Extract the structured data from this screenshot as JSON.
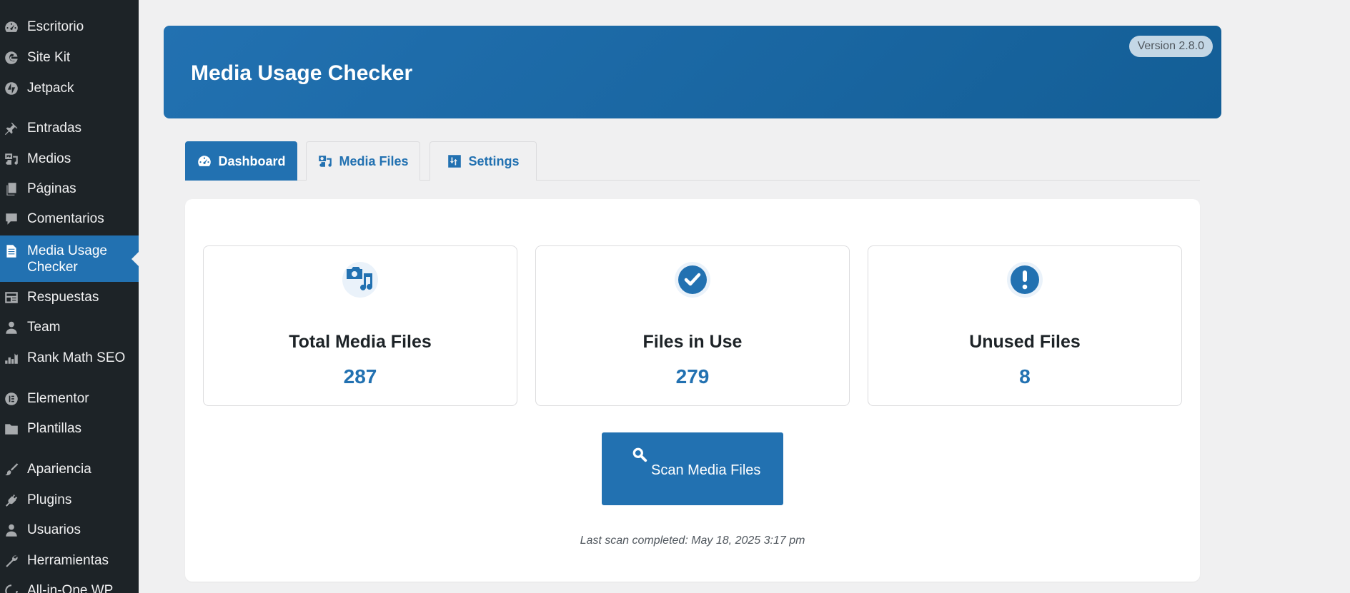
{
  "sidebar": {
    "items": [
      {
        "label": "Escritorio",
        "icon": "dashboard-icon"
      },
      {
        "label": "Site Kit",
        "icon": "google-g-icon"
      },
      {
        "label": "Jetpack",
        "icon": "jetpack-icon"
      },
      {
        "label": "Entradas",
        "icon": "pushpin-icon"
      },
      {
        "label": "Medios",
        "icon": "media-icon"
      },
      {
        "label": "Páginas",
        "icon": "page-icon"
      },
      {
        "label": "Comentarios",
        "icon": "comment-icon"
      },
      {
        "label": "Media Usage Checker",
        "icon": "document-icon",
        "active": true
      },
      {
        "label": "Respuestas",
        "icon": "feedback-icon"
      },
      {
        "label": "Team",
        "icon": "person-icon"
      },
      {
        "label": "Rank Math SEO",
        "icon": "rank-math-icon"
      },
      {
        "label": "Elementor",
        "icon": "elementor-icon"
      },
      {
        "label": "Plantillas",
        "icon": "folder-icon"
      },
      {
        "label": "Apariencia",
        "icon": "paintbrush-icon"
      },
      {
        "label": "Plugins",
        "icon": "plug-icon"
      },
      {
        "label": "Usuarios",
        "icon": "user-icon"
      },
      {
        "label": "Herramientas",
        "icon": "wrench-icon"
      },
      {
        "label": "All-in-One WP",
        "icon": "migration-icon"
      }
    ],
    "active_label_line1": "Media Usage",
    "active_label_line2": "Checker"
  },
  "header": {
    "title": "Media Usage Checker",
    "version": "Version 2.8.0"
  },
  "tabs": [
    {
      "label": "Dashboard",
      "icon": "dashboard-gauge-icon",
      "active": true
    },
    {
      "label": "Media Files",
      "icon": "media-files-icon",
      "active": false
    },
    {
      "label": "Settings",
      "icon": "settings-sliders-icon",
      "active": false
    }
  ],
  "stats": [
    {
      "label": "Total Media Files",
      "value": "287",
      "icon": "media-camera-music-icon"
    },
    {
      "label": "Files in Use",
      "value": "279",
      "icon": "checkmark-circle-icon"
    },
    {
      "label": "Unused Files",
      "value": "8",
      "icon": "exclamation-circle-icon"
    }
  ],
  "scan": {
    "button_label": "Scan Media Files",
    "icon": "search-icon",
    "last_scan": "Last scan completed: May 18, 2025 3:17 pm"
  },
  "colors": {
    "accent": "#2271b1",
    "sidebar_bg": "#1d2327",
    "page_bg": "#f0f0f1"
  }
}
